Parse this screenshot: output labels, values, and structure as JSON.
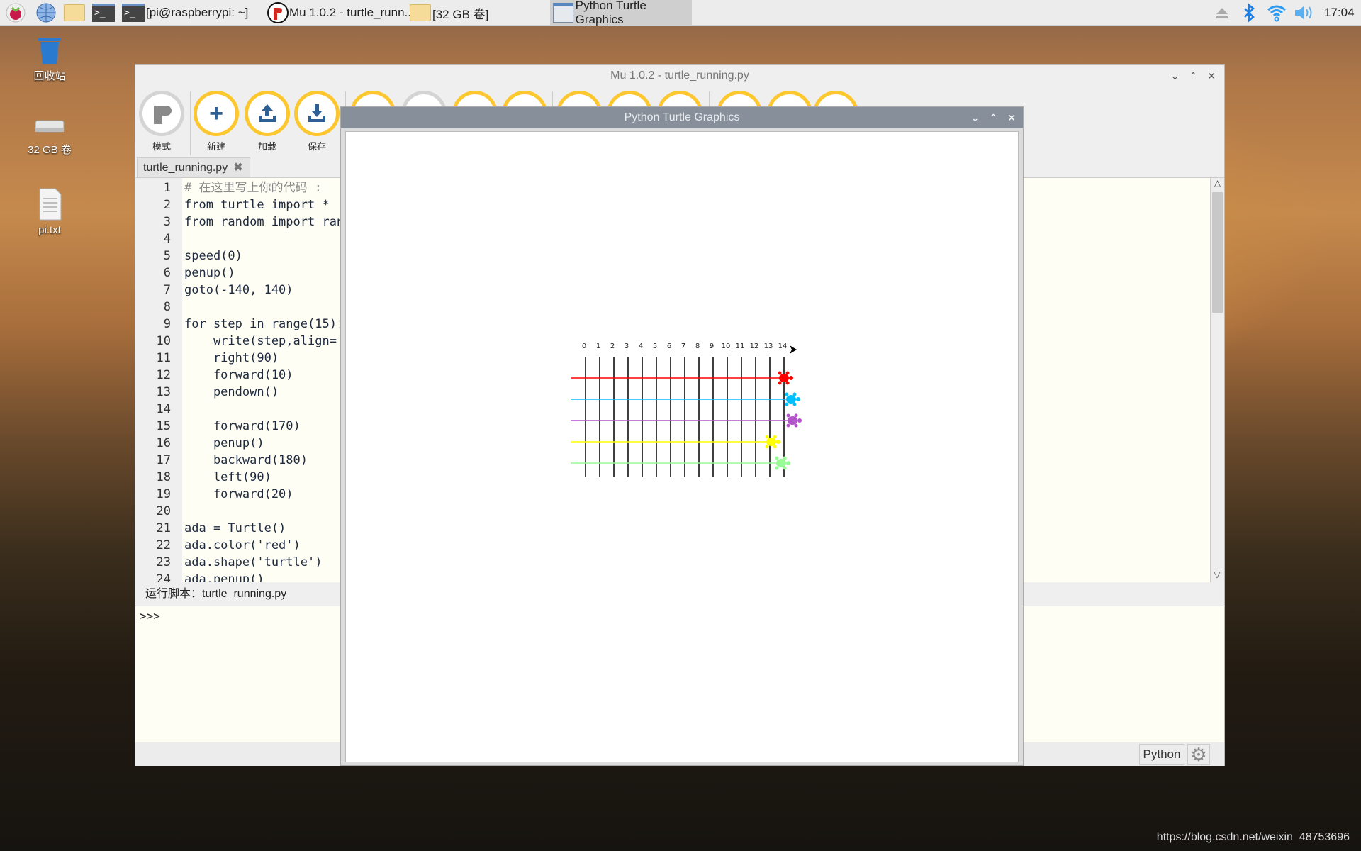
{
  "taskbar": {
    "items": [
      {
        "label": "[pi@raspberrypi: ~]"
      },
      {
        "label": "Mu 1.0.2 - turtle_runn..."
      },
      {
        "label": "[32 GB 卷]"
      },
      {
        "label": "Python Turtle Graphics"
      }
    ],
    "clock": "17:04"
  },
  "desktop": {
    "icons": [
      {
        "label": "回收站"
      },
      {
        "label": "32 GB 卷"
      },
      {
        "label": "pi.txt"
      }
    ]
  },
  "mu": {
    "title": "Mu 1.0.2 - turtle_running.py",
    "toolbar": [
      {
        "label": "模式",
        "icon": "mode-icon"
      },
      {
        "label": "新建",
        "icon": "plus-icon"
      },
      {
        "label": "加载",
        "icon": "upload-icon"
      },
      {
        "label": "保存",
        "icon": "download-icon"
      }
    ],
    "tab": "turtle_running.py",
    "code": [
      "# 在这里写上你的代码 :",
      "from turtle import *",
      "from random import ran",
      "",
      "speed(0)",
      "penup()",
      "goto(-140, 140)",
      "",
      "for step in range(15):",
      "    write(step,align='",
      "    right(90)",
      "    forward(10)",
      "    pendown()",
      "",
      "    forward(170)",
      "    penup()",
      "    backward(180)",
      "    left(90)",
      "    forward(20)",
      "",
      "ada = Turtle()",
      "ada.color('red')",
      "ada.shape('turtle')",
      "ada.penup()"
    ],
    "status": "运行脚本：turtle_running.py",
    "repl_prompt": ">>>",
    "mode_button": "Python"
  },
  "turtle": {
    "title": "Python Turtle Graphics",
    "labels": [
      "0",
      "1",
      "2",
      "3",
      "4",
      "5",
      "6",
      "7",
      "8",
      "9",
      "10",
      "11",
      "12",
      "13",
      "14"
    ],
    "turtles": [
      {
        "color": "#ff0000",
        "position": 14
      },
      {
        "color": "#00bfff",
        "position": 14.5
      },
      {
        "color": "#b452cd",
        "position": 14.6
      },
      {
        "color": "#ffff00",
        "position": 13.1
      },
      {
        "color": "#98fb98",
        "position": 13.8
      }
    ]
  },
  "watermark": "https://blog.csdn.net/weixin_48753696"
}
